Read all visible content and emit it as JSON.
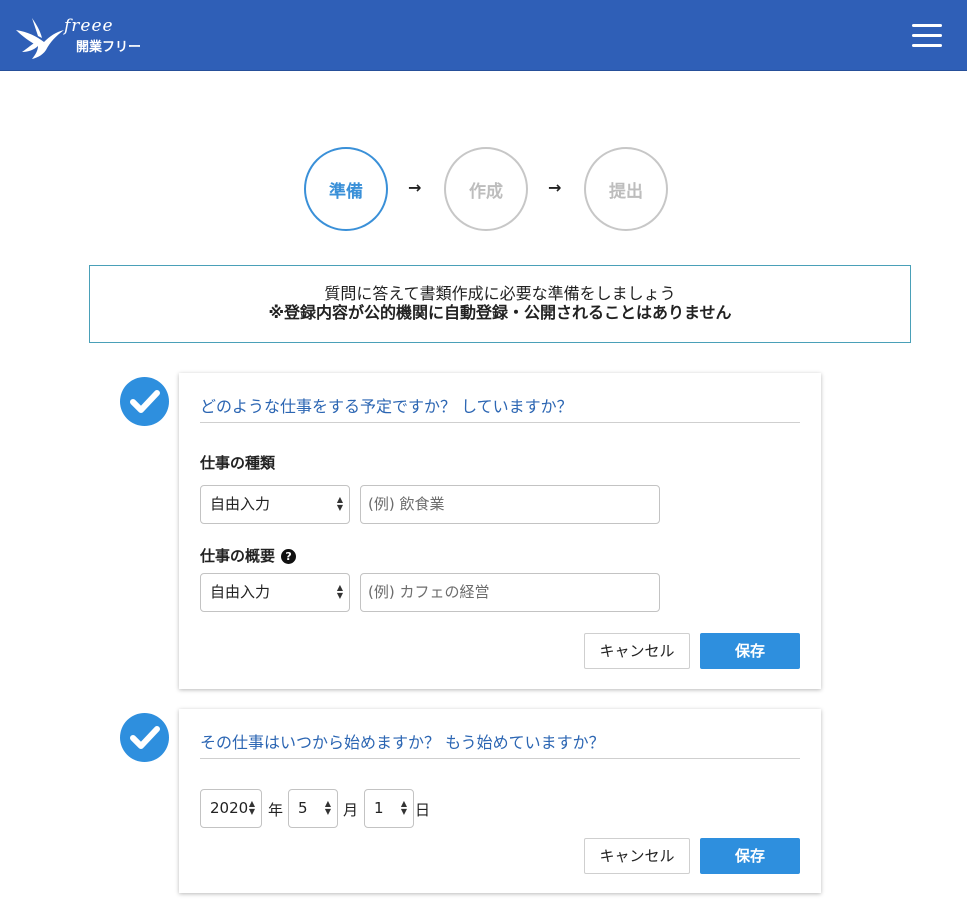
{
  "header": {
    "logo_script": "freee",
    "logo_sub": "開業フリー",
    "menu_icon": "hamburger-icon",
    "bg_color": "#2f5fb7"
  },
  "steps": [
    {
      "label": "準備",
      "state": "active"
    },
    {
      "label": "作成",
      "state": "inactive"
    },
    {
      "label": "提出",
      "state": "inactive"
    }
  ],
  "step_arrow": "→",
  "notice": {
    "line1": "質問に答えて書類作成に必要な準備をしましょう",
    "line2": "※登録内容が公的機関に自動登録・公開されることはありません"
  },
  "cards": [
    {
      "question": "どのような仕事をする予定ですか？ していますか？",
      "completed": true,
      "fields": [
        {
          "label": "仕事の種類",
          "select_value": "自由入力",
          "input_placeholder": "(例) 飲食業",
          "has_help": false
        },
        {
          "label": "仕事の概要",
          "select_value": "自由入力",
          "input_placeholder": "(例) カフェの経営",
          "has_help": true
        }
      ],
      "cancel_label": "キャンセル",
      "save_label": "保存"
    },
    {
      "question": "その仕事はいつから始めますか？ もう始めていますか？",
      "completed": true,
      "date": {
        "year": "2020",
        "year_unit": "年",
        "month": "5",
        "month_unit": "月",
        "day": "1",
        "day_unit": "日"
      },
      "cancel_label": "キャンセル",
      "save_label": "保存"
    }
  ],
  "help_glyph": "?",
  "select_caret": "▲▼",
  "colors": {
    "accent": "#2e8fde",
    "question_text": "#2c66b3",
    "notice_border": "#4aa0b8"
  }
}
